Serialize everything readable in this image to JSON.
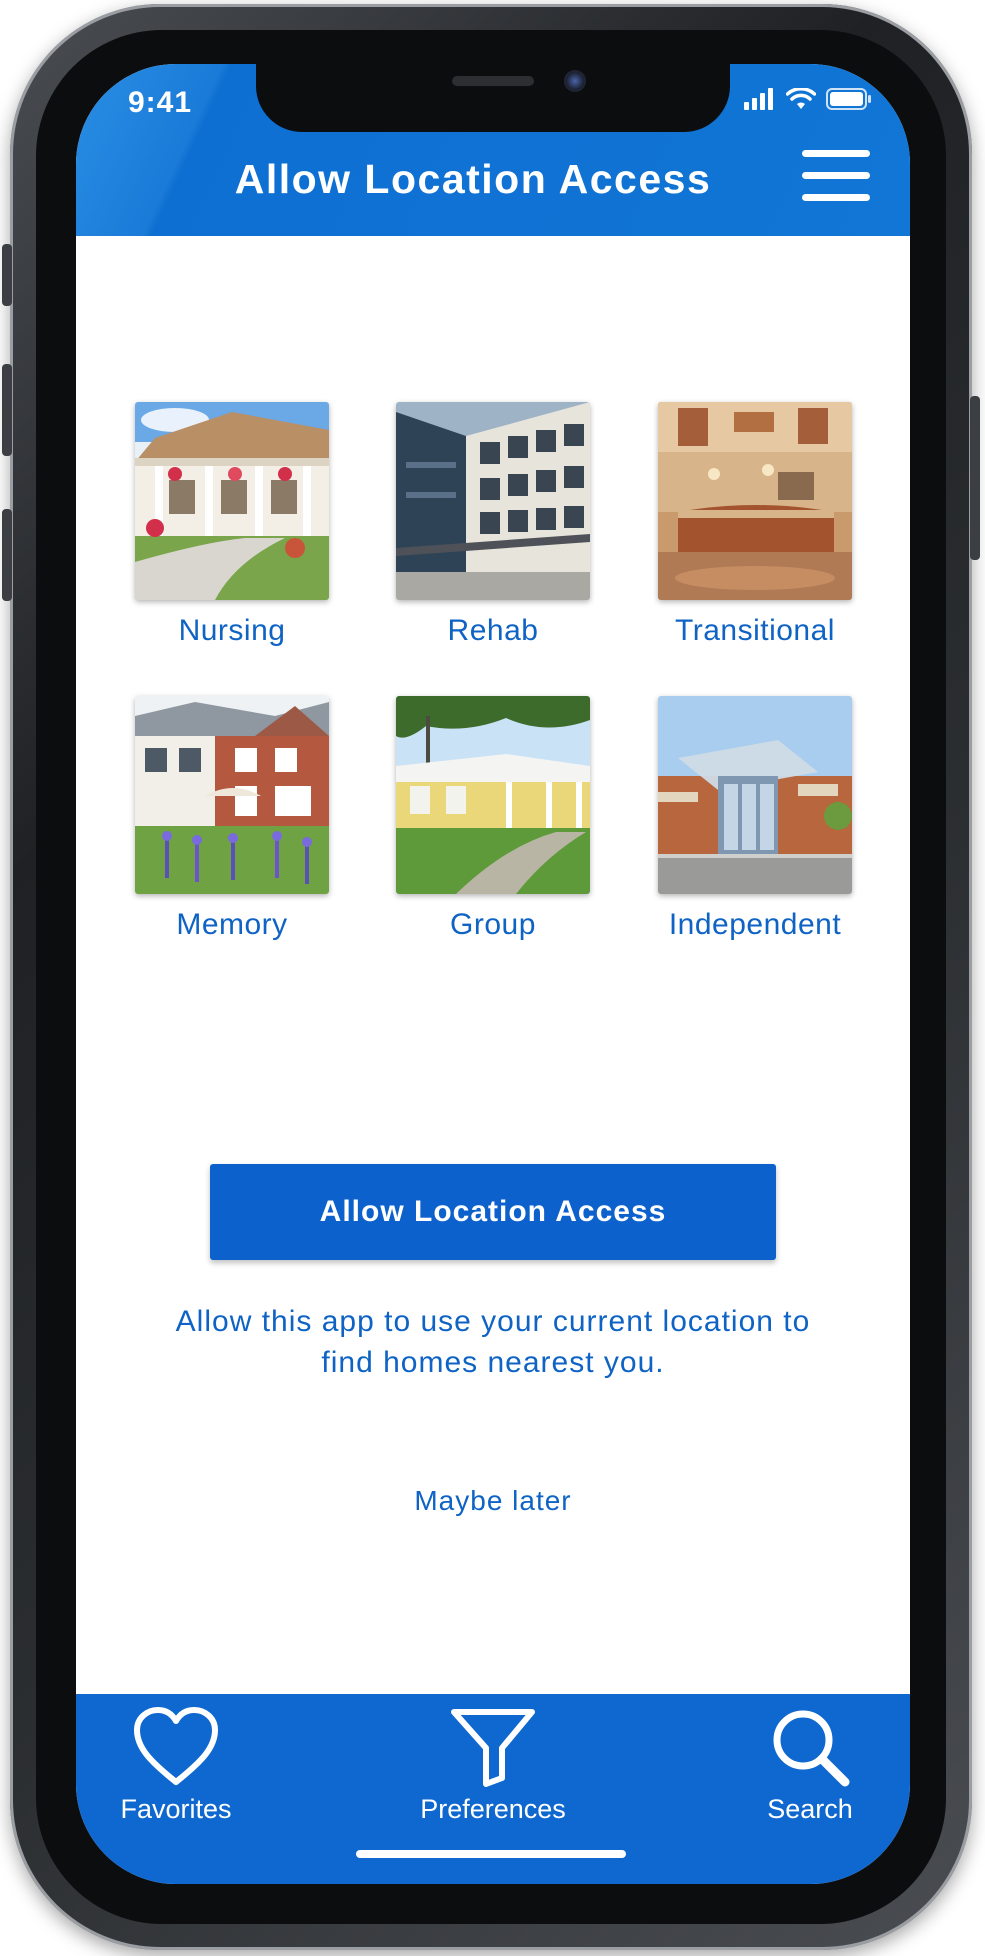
{
  "status_bar": {
    "time": "9:41"
  },
  "header": {
    "title": "Allow Location Access"
  },
  "categories": [
    {
      "label": "Nursing"
    },
    {
      "label": "Rehab"
    },
    {
      "label": "Transitional"
    },
    {
      "label": "Memory"
    },
    {
      "label": "Group"
    },
    {
      "label": "Independent"
    }
  ],
  "cta": {
    "label": "Allow Location Access",
    "description": "Allow this app to use your current location to find homes nearest you.",
    "secondary_label": "Maybe later"
  },
  "tabbar": {
    "items": [
      {
        "label": "Favorites",
        "icon": "heart-icon"
      },
      {
        "label": "Preferences",
        "icon": "filter-icon"
      },
      {
        "label": "Search",
        "icon": "search-icon"
      }
    ]
  },
  "colors": {
    "brand_blue": "#0E68CF",
    "text_blue": "#0E63C4",
    "button_blue": "#0C61CC"
  }
}
